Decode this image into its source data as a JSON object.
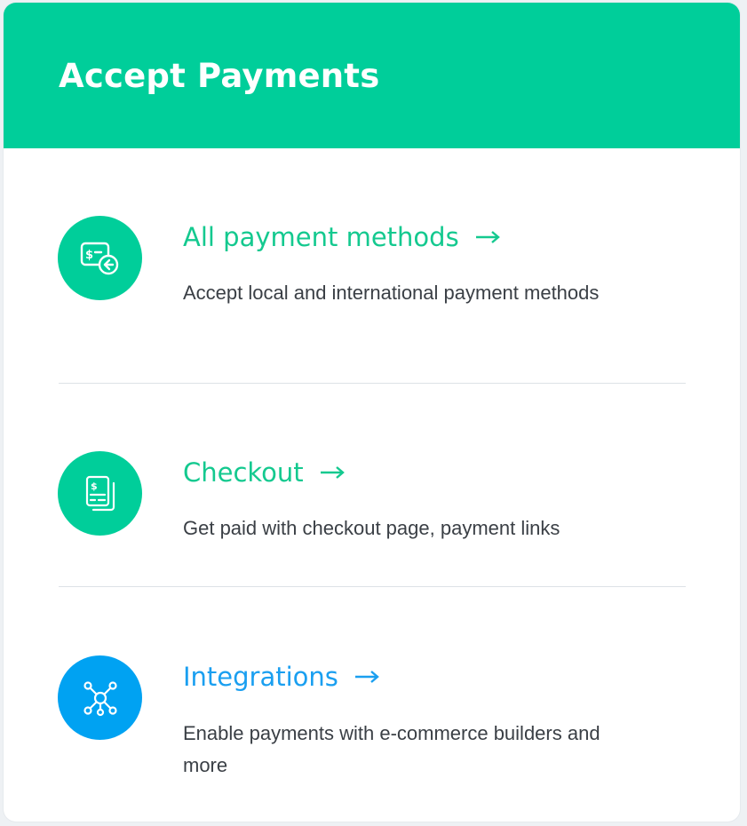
{
  "header": {
    "title": "Accept Payments"
  },
  "colors": {
    "header_bg": "#00ce9a",
    "green_accent": "#00ce9a",
    "blue_accent": "#00a2f2"
  },
  "items": [
    {
      "title": "All payment methods",
      "description": "Accept local and international payment methods",
      "icon": "payment-methods-icon",
      "accent": "green"
    },
    {
      "title": "Checkout",
      "description": "Get paid with checkout page, payment links",
      "icon": "checkout-document-icon",
      "accent": "green"
    },
    {
      "title": "Integrations",
      "description": "Enable payments with e-commerce builders and more",
      "icon": "integrations-network-icon",
      "accent": "blue"
    }
  ]
}
